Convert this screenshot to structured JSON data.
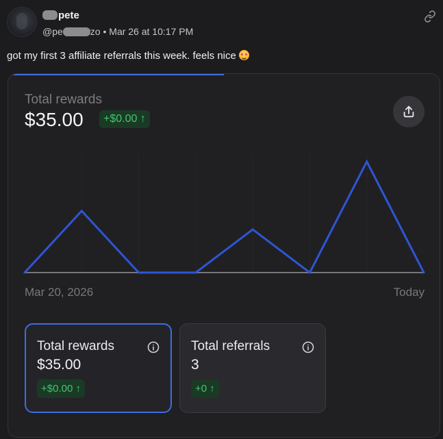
{
  "post": {
    "display_name_visible": "pete",
    "handle_prefix": "@pe",
    "handle_suffix": "zo",
    "timestamp": "• Mar 26 at 10:17 PM",
    "text": "got my first 3 affiliate referrals this week. feels nice",
    "icons": {
      "link": "link-icon",
      "emoji": "smiling-face-with-hearts-emoji"
    }
  },
  "card": {
    "total_rewards_label": "Total rewards",
    "total_rewards_value": "$35.00",
    "change_pill": "+$0.00 ↑",
    "share_icon": "share-upload-icon",
    "x_axis_start": "Mar 20, 2026",
    "x_axis_end": "Today",
    "stats": [
      {
        "title": "Total rewards",
        "value": "$35.00",
        "change": "+$0.00 ↑",
        "icon": "info-icon"
      },
      {
        "title": "Total referrals",
        "value": "3",
        "change": "+0 ↑",
        "icon": "info-icon"
      }
    ],
    "colors": {
      "accent": "#3e6fd8",
      "positive": "#46c46d",
      "positive_bg": "#1a3a26"
    }
  },
  "chart_data": {
    "type": "line",
    "title": "",
    "xlabel": "",
    "ylabel": "",
    "x": [
      "Mar 20, 2026",
      "",
      "",
      "",
      "",
      "",
      "",
      "Today"
    ],
    "series": [
      {
        "values": [
          0,
          10,
          0,
          0,
          7,
          0,
          18,
          0
        ]
      }
    ],
    "ylim": [
      0,
      20
    ],
    "grid": "vertical dotted",
    "legend": "none",
    "line_color": "#2f55d4"
  }
}
